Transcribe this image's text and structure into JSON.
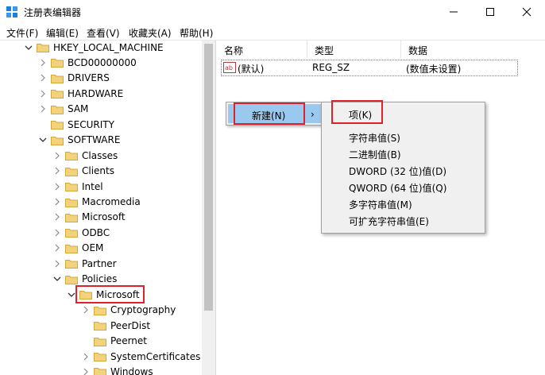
{
  "window": {
    "title": "注册表编辑器"
  },
  "menu": [
    "文件(F)",
    "编辑(E)",
    "查看(V)",
    "收藏夹(A)",
    "帮助(H)"
  ],
  "tree": [
    {
      "label": "HKEY_LOCAL_MACHINE",
      "arrow": "expanded"
    },
    {
      "label": "BCD00000000",
      "arrow": "collapsed"
    },
    {
      "label": "DRIVERS",
      "arrow": "collapsed"
    },
    {
      "label": "HARDWARE",
      "arrow": "collapsed"
    },
    {
      "label": "SAM",
      "arrow": "collapsed"
    },
    {
      "label": "SECURITY",
      "arrow": "none"
    },
    {
      "label": "SOFTWARE",
      "arrow": "expanded"
    },
    {
      "label": "Classes",
      "arrow": "collapsed"
    },
    {
      "label": "Clients",
      "arrow": "collapsed"
    },
    {
      "label": "Intel",
      "arrow": "collapsed"
    },
    {
      "label": "Macromedia",
      "arrow": "collapsed"
    },
    {
      "label": "Microsoft",
      "arrow": "collapsed"
    },
    {
      "label": "ODBC",
      "arrow": "collapsed"
    },
    {
      "label": "OEM",
      "arrow": "collapsed"
    },
    {
      "label": "Partner",
      "arrow": "collapsed"
    },
    {
      "label": "Policies",
      "arrow": "expanded"
    },
    {
      "label": "Microsoft",
      "arrow": "expanded",
      "selected": true
    },
    {
      "label": "Cryptography",
      "arrow": "collapsed"
    },
    {
      "label": "PeerDist",
      "arrow": "none"
    },
    {
      "label": "Peernet",
      "arrow": "none"
    },
    {
      "label": "SystemCertificates",
      "arrow": "collapsed"
    },
    {
      "label": "Windows",
      "arrow": "collapsed"
    }
  ],
  "list": {
    "columns": [
      "名称",
      "类型",
      "数据"
    ],
    "rows": [
      {
        "name": "(默认)",
        "type": "REG_SZ",
        "data": "(数值未设置)",
        "icon": "string-value-icon"
      }
    ]
  },
  "context_menu": {
    "new_label": "新建(N)",
    "new_arrow": "›"
  },
  "submenu": {
    "items": [
      "项(K)",
      "字符串值(S)",
      "二进制值(B)",
      "DWORD (32 位)值(D)",
      "QWORD (64 位)值(Q)",
      "多字符串值(M)",
      "可扩充字符串值(E)"
    ]
  },
  "colors": {
    "highlight": "#99c9ef",
    "annotation_red": "#e0202a",
    "folder": "#f2d27a"
  }
}
